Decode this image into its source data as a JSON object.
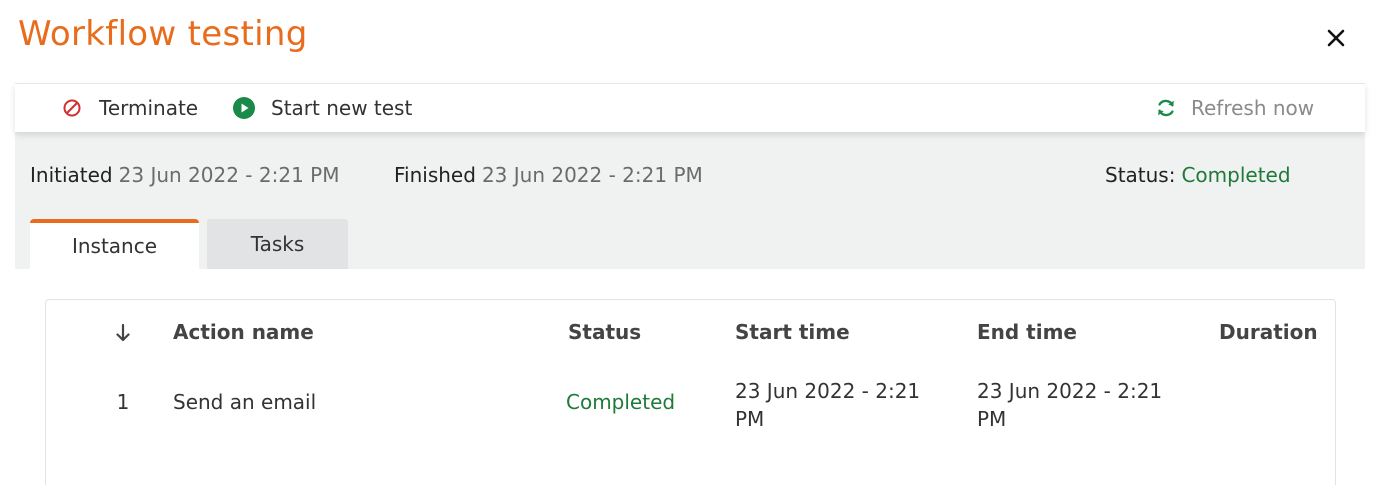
{
  "header": {
    "title": "Workflow testing",
    "close_icon": "close-icon"
  },
  "toolbar": {
    "terminate_label": "Terminate",
    "start_label": "Start new test",
    "refresh_label": "Refresh now"
  },
  "info": {
    "initiated_label": "Initiated",
    "initiated_value": "23 Jun 2022 - 2:21 PM",
    "finished_label": "Finished",
    "finished_value": "23 Jun 2022 - 2:21 PM",
    "status_label": "Status:",
    "status_value": "Completed"
  },
  "tabs": [
    {
      "label": "Instance",
      "active": true
    },
    {
      "label": "Tasks",
      "active": false
    }
  ],
  "table": {
    "columns": [
      "Action name",
      "Status",
      "Start time",
      "End time",
      "Duration"
    ],
    "sort_icon": "arrow-down-icon",
    "rows": [
      {
        "index": "1",
        "action_name": "Send an email",
        "status": "Completed",
        "start_time": "23 Jun 2022 - 2:21 PM",
        "end_time": "23 Jun 2022 - 2:21 PM",
        "duration": ""
      }
    ]
  },
  "colors": {
    "accent": "#e86c1c",
    "success": "#1f7a3a",
    "terminate": "#d0312d",
    "start": "#1a8a4a",
    "refresh": "#1a8a4a"
  }
}
